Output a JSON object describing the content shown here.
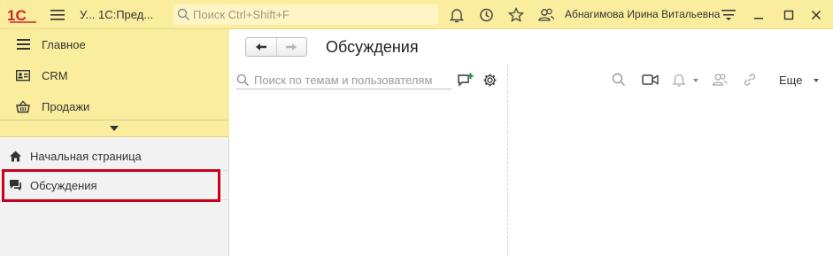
{
  "topbar": {
    "app_title": "У... 1С:Пред...",
    "search_placeholder": "Поиск Ctrl+Shift+F",
    "user_name": "Абнагимова Ирина Витальевна"
  },
  "sidebar": {
    "sections": [
      {
        "label": "Главное",
        "icon": "menu-lines-icon"
      },
      {
        "label": "CRM",
        "icon": "contacts-card-icon"
      },
      {
        "label": "Продажи",
        "icon": "basket-icon"
      }
    ],
    "nav": {
      "home_label": "Начальная страница",
      "discussions_label": "Обсуждения"
    }
  },
  "main": {
    "title": "Обсуждения",
    "search_placeholder": "Поиск по темам и пользователям",
    "more_label": "Еще"
  },
  "colors": {
    "topbar_bg": "#fbed9e",
    "sidebar_bottom_bg": "#f2f2f2",
    "highlight": "#c8001e",
    "logo_red": "#d2232a",
    "accent_green": "#2c8a3e"
  }
}
